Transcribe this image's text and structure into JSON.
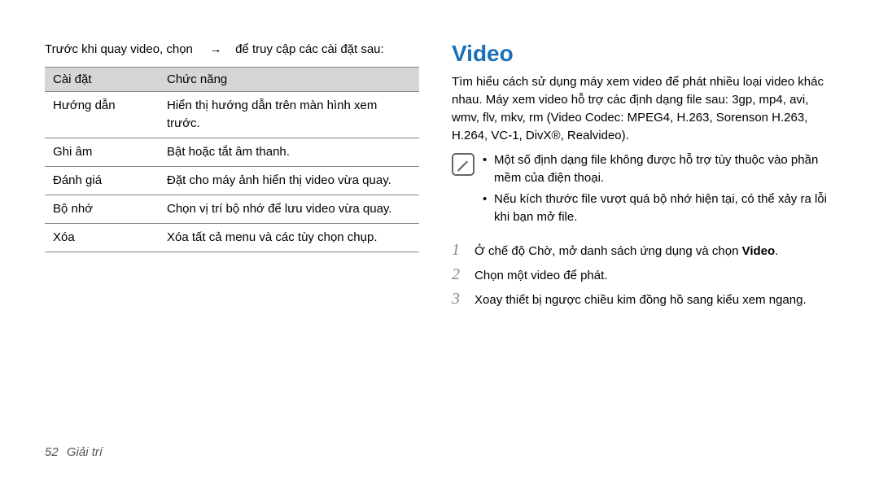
{
  "left": {
    "intro_pre": "Trước khi quay video, chọn",
    "intro_arrow": "→",
    "intro_post": "để truy cập các cài đặt sau:",
    "table": {
      "header_setting": "Cài đặt",
      "header_function": "Chức năng",
      "rows": [
        {
          "name": "Hướng dẫn",
          "desc": "Hiển thị hướng dẫn trên màn hình xem trước."
        },
        {
          "name": "Ghi âm",
          "desc": "Bật hoặc tắt âm thanh."
        },
        {
          "name": "Đánh giá",
          "desc": "Đặt cho máy ảnh hiển thị video vừa quay."
        },
        {
          "name": "Bộ nhớ",
          "desc": "Chọn vị trí bộ nhớ để lưu video vừa quay."
        },
        {
          "name": "Xóa",
          "desc": "Xóa tất cả menu và các tùy chọn chụp."
        }
      ]
    }
  },
  "right": {
    "title": "Video",
    "desc": "Tìm hiểu cách sử dụng máy xem video để phát nhiều loại video khác nhau. Máy xem video hỗ trợ các định dạng file sau: 3gp, mp4, avi, wmv, flv, mkv, rm (Video Codec: MPEG4, H.263, Sorenson H.263, H.264, VC-1, DivX®, Realvideo).",
    "notes": [
      "Một số định dạng file không được hỗ trợ tùy thuộc vào phần mềm của điện thoại.",
      "Nếu kích thước file vượt quá bộ nhớ hiện tại, có thể xảy ra lỗi khi bạn mở file."
    ],
    "steps": [
      {
        "num": "1",
        "text_pre": "Ở chế độ Chờ, mở danh sách ứng dụng và chọn ",
        "bold": "Video",
        "text_post": "."
      },
      {
        "num": "2",
        "text_pre": "Chọn một video để phát.",
        "bold": "",
        "text_post": ""
      },
      {
        "num": "3",
        "text_pre": "Xoay thiết bị ngược chiều kim đồng hồ sang kiểu xem ngang.",
        "bold": "",
        "text_post": ""
      }
    ]
  },
  "footer": {
    "page_number": "52",
    "section": "Giải trí"
  }
}
